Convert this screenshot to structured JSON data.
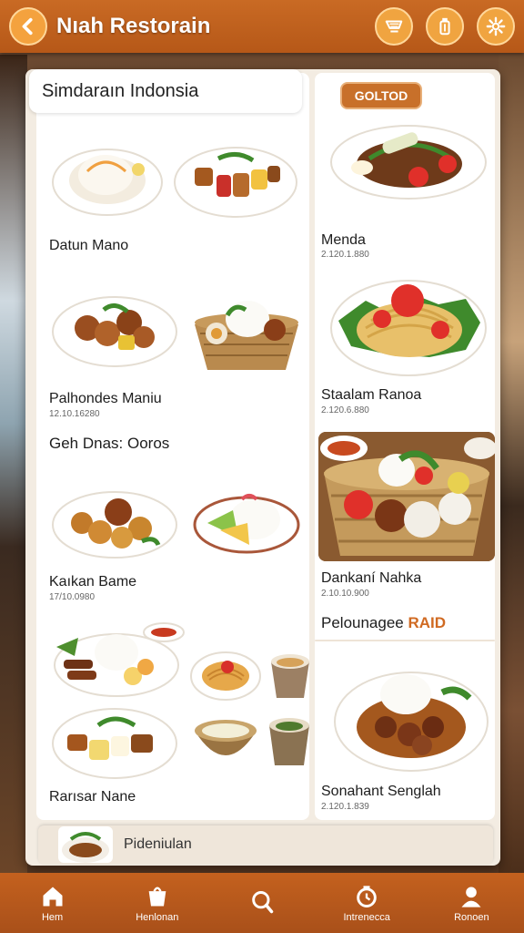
{
  "app": {
    "title": "Nıah Restorain"
  },
  "top_actions": [
    {
      "icon": "cart-icon"
    },
    {
      "icon": "bottle-icon"
    },
    {
      "icon": "gear-icon"
    }
  ],
  "section": {
    "title": "Simdaraın Indonsia",
    "badge": "GOLTOD"
  },
  "left_items": [
    {
      "name": "Datun Mano",
      "sub": ""
    },
    {
      "name": "Palhondes Maniu",
      "sub": "12.10.16280"
    },
    {
      "name": "Kaıkan Bame",
      "sub": "17/10.0980"
    },
    {
      "name": "Rarısar Nane",
      "sub": ""
    }
  ],
  "category_label": "Geh Dnas: Ooros",
  "right_items": [
    {
      "name": "Menda",
      "sub": "2.120.1.880"
    },
    {
      "name": "Staalam Ranoa",
      "sub": "2.120.6.880"
    },
    {
      "name": "Dankaní Nahka",
      "sub": "2.10.10.900"
    },
    {
      "name": "Sonahant Senglah",
      "sub": "2.120.1.839"
    }
  ],
  "promo": {
    "label": "Pelounagee",
    "tag": "RAID"
  },
  "strip": {
    "label": "Pideniulan"
  },
  "bottom_nav": [
    {
      "label": "Hem",
      "icon": "home-icon"
    },
    {
      "label": "Henlonan",
      "icon": "menu-bag-icon"
    },
    {
      "label": "",
      "icon": "search-icon"
    },
    {
      "label": "Intrenecca",
      "icon": "clock-icon"
    },
    {
      "label": "Ronoen",
      "icon": "profile-icon"
    }
  ],
  "colors": {
    "brand": "#c96a24",
    "accent": "#f0a440",
    "tag": "#d06a22"
  }
}
